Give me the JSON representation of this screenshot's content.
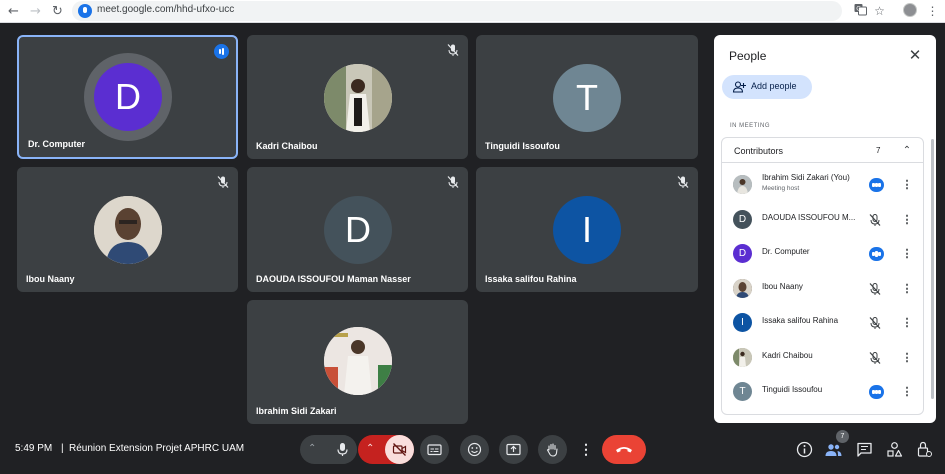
{
  "browser": {
    "url": "meet.google.com/hhd-ufxo-ucc"
  },
  "tiles": [
    {
      "name": "Dr. Computer",
      "initial": "D",
      "color": "#5b2ed1"
    },
    {
      "name": "Kadri Chaibou"
    },
    {
      "name": "Tinguidi Issoufou",
      "initial": "T",
      "color": "#6f8693"
    },
    {
      "name": "Ibou Naany"
    },
    {
      "name": "DAOUDA ISSOUFOU Maman Nasser",
      "initial": "D",
      "color": "#44525b"
    },
    {
      "name": "Issaka salifou Rahina",
      "initial": "I",
      "color": "#0d54a3"
    },
    {
      "name": "Ibrahim Sidi Zakari"
    }
  ],
  "panel": {
    "title": "People",
    "add_people": "Add people",
    "section": "IN MEETING",
    "contributors_label": "Contributors",
    "contributors_count": "7",
    "participants": [
      {
        "name": "Ibrahim Sidi Zakari (You)",
        "sub": "Meeting host",
        "initial": "",
        "color": "#8a9496",
        "state": "speaking"
      },
      {
        "name": "DAOUDA ISSOUFOU M...",
        "initial": "D",
        "color": "#44525b",
        "state": "muted"
      },
      {
        "name": "Dr. Computer",
        "initial": "D",
        "color": "#5b2ed1",
        "state": "speaking"
      },
      {
        "name": "Ibou Naany",
        "initial": "",
        "color": "#4b4036",
        "state": "muted"
      },
      {
        "name": "Issaka salifou Rahina",
        "initial": "I",
        "color": "#0d54a3",
        "state": "muted"
      },
      {
        "name": "Kadri Chaibou",
        "initial": "",
        "color": "#9c9a84",
        "state": "muted"
      },
      {
        "name": "Tinguidi Issoufou",
        "initial": "T",
        "color": "#6f8693",
        "state": "speaking"
      }
    ]
  },
  "bottom": {
    "time": "5:49 PM",
    "separator": "|",
    "meeting_title": "Réunion Extension Projet APHRC UAM",
    "people_badge": "7"
  }
}
